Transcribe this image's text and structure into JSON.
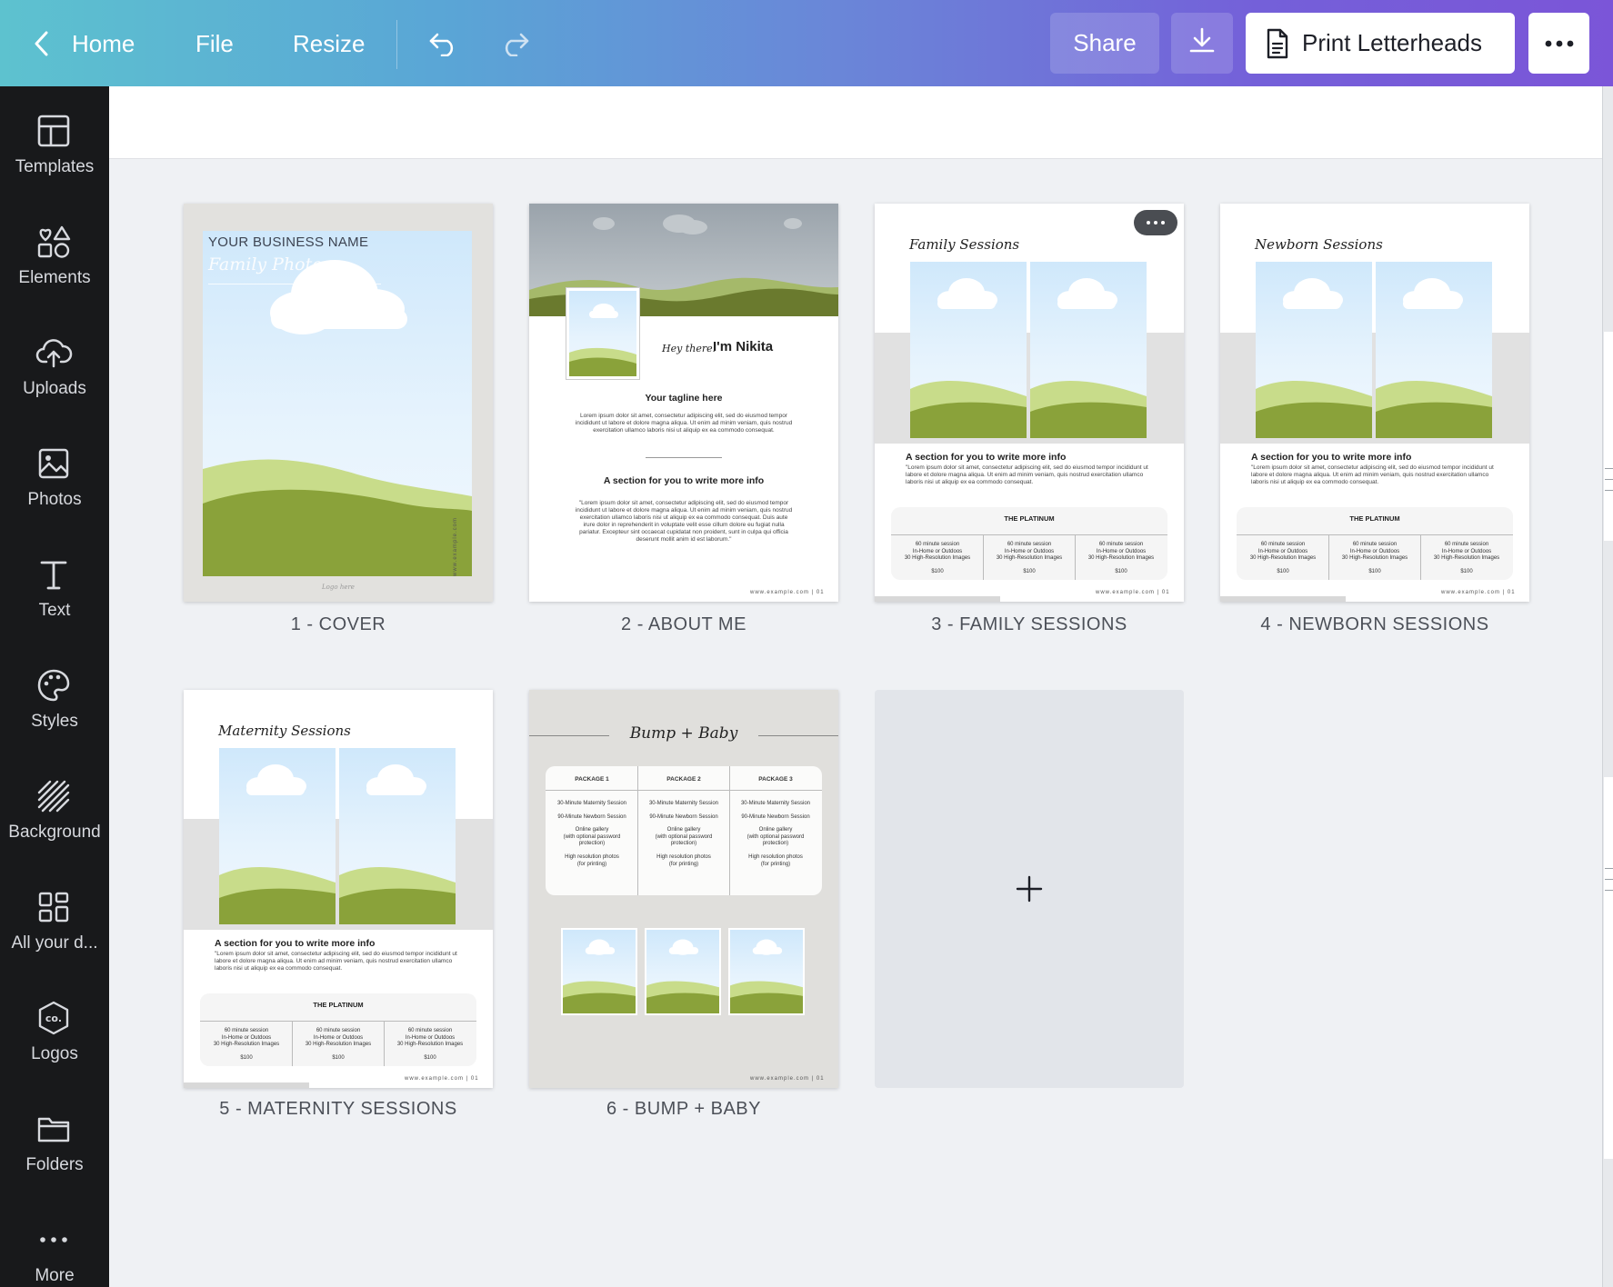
{
  "topbar": {
    "home_label": "Home",
    "file_label": "File",
    "resize_label": "Resize",
    "share_label": "Share",
    "print_label": "Print Letterheads"
  },
  "sidebar": {
    "items": [
      {
        "label": "Templates",
        "icon": "templates-icon"
      },
      {
        "label": "Elements",
        "icon": "elements-icon"
      },
      {
        "label": "Uploads",
        "icon": "uploads-icon"
      },
      {
        "label": "Photos",
        "icon": "photos-icon"
      },
      {
        "label": "Text",
        "icon": "text-icon"
      },
      {
        "label": "Styles",
        "icon": "styles-icon"
      },
      {
        "label": "Background",
        "icon": "background-icon"
      },
      {
        "label": "All your d...",
        "icon": "all-designs-icon"
      },
      {
        "label": "Logos",
        "icon": "logos-icon"
      },
      {
        "label": "Folders",
        "icon": "folders-icon"
      },
      {
        "label": "More",
        "icon": "more-icon"
      }
    ]
  },
  "pages": [
    {
      "title": "1 - COVER"
    },
    {
      "title": "2 - ABOUT ME"
    },
    {
      "title": "3 - FAMILY SESSIONS"
    },
    {
      "title": "4 - NEWBORN SESSIONS"
    },
    {
      "title": "5 - MATERNITY SESSIONS"
    },
    {
      "title": "6 - BUMP + BABY"
    }
  ],
  "cover": {
    "business": "YOUR BUSINESS NAME",
    "script": "Family Photos",
    "side_url": "www.example.com",
    "logo": "Logo here"
  },
  "about": {
    "hey": "Hey there!",
    "name": "I'm Nikita",
    "tagline": "Your tagline here",
    "body1": "Lorem ipsum dolor sit amet, consectetur adipiscing elit, sed do eiusmod tempor incididunt ut labore et dolore magna aliqua. Ut enim ad minim veniam, quis nostrud exercitation ullamco laboris nisi ut aliquip ex ea commodo consequat.",
    "section": "A section for you to write more info",
    "body2": "\"Lorem ipsum dolor sit amet, consectetur adipiscing elit, sed do eiusmod tempor incididunt ut labore et dolore magna aliqua. Ut enim ad minim veniam, quis nostrud exercitation ullamco laboris nisi ut aliquip ex ea commodo consequat. Duis aute irure dolor in reprehenderit in voluptate velit esse cillum dolore eu fugiat nulla pariatur. Excepteur sint occaecat cupidatat non proident, sunt in culpa qui officia deserunt mollit anim id est laborum.\"",
    "url": "www.example.com | 01"
  },
  "sessions": {
    "family_script": "Family Sessions",
    "newborn_script": "Newborn Sessions",
    "maternity_script": "Maternity Sessions",
    "section": "A section for you to write more info",
    "body": "\"Lorem ipsum dolor sit amet, consectetur adipiscing elit, sed do eiusmod tempor incididunt ut labore et dolore magna aliqua. Ut enim ad minim veniam, quis nostrud exercitation ullamco laboris nisi ut aliquip ex ea commodo consequat.",
    "platinum": "THE PLATINUM",
    "cell": "60 minute session\nIn-Home or Outdoos\n30 High-Resolution Images",
    "price": "$100",
    "url": "www.example.com | 01"
  },
  "bump": {
    "script": "Bump + Baby",
    "packages": [
      "PACKAGE 1",
      "PACKAGE 2",
      "PACKAGE 3"
    ],
    "rows": [
      [
        "30-Minute Maternity Session",
        "30-Minute Maternity Session",
        "30-Minute Maternity Session"
      ],
      [
        "90-Minute Newborn Session",
        "90-Minute Newborn Session",
        "90-Minute Newborn Session"
      ],
      [
        "Online gallery\n(with optional password protection)",
        "Online gallery\n(with optional password protection)",
        "Online gallery\n(with optional password protection)"
      ],
      [
        "High resolution photos\n(for printing)",
        "High resolution photos\n(for printing)",
        "High resolution photos\n(for printing)"
      ]
    ],
    "url": "www.example.com | 01"
  },
  "colors": {
    "grass_light": "#c8dc8a",
    "grass_dark": "#8aa23a",
    "hill_dark": "#6a7a2e",
    "sidebar_bg": "#18191b"
  }
}
